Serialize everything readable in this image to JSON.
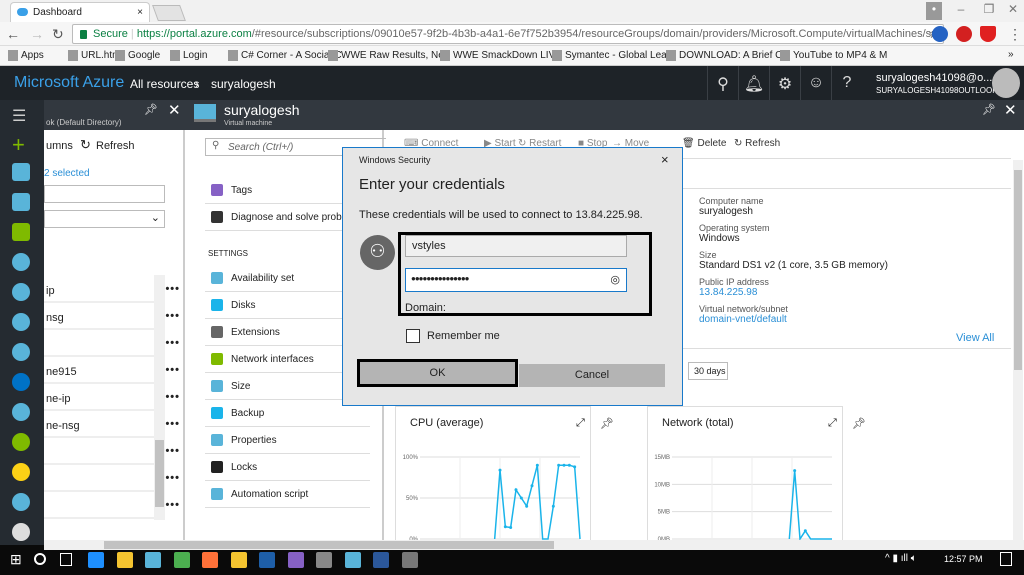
{
  "browser": {
    "tab_title": "Dashboard",
    "secure_label": "Secure",
    "url_host": "https://portal.azure.com",
    "url_rest": "/#resource/subscriptions/09010e57-9f2b-4b3b-a4a1-6e7f752b3954/resourceGroups/domain/providers/Microsoft.Compute/virtualMachines/su",
    "bookmarks": [
      "Apps",
      "URL.html",
      "Google",
      "Login",
      "C# Corner - A Social C",
      "WWE Raw Results, Ne",
      "WWE SmackDown LIV",
      "Symantec - Global Lea",
      "DOWNLOAD: A Brief C",
      "YouTube to MP4 & M"
    ],
    "more": "»"
  },
  "azure": {
    "brand": "Microsoft Azure",
    "crumbs": [
      "All resources",
      "suryalogesh"
    ],
    "user_email": "suryalogesh41098@o...",
    "user_dir": "SURYALOGESH41098OUTLOOK..."
  },
  "blade1": {
    "subtitle": "ok (Default Directory)",
    "columns_label": "umns",
    "refresh_label": "Refresh",
    "selected_label": "2 selected",
    "rows": [
      "ip",
      "nsg",
      "",
      "ne915",
      "ne-ip",
      "ne-nsg",
      "",
      "",
      ""
    ]
  },
  "blade2": {
    "title": "suryalogesh",
    "subtitle": "Virtual machine",
    "search_placeholder": "Search (Ctrl+/)",
    "items_top": [
      "Tags",
      "Diagnose and solve problems"
    ],
    "settings_header": "SETTINGS",
    "settings": [
      "Availability set",
      "Disks",
      "Extensions",
      "Network interfaces",
      "Size",
      "Backup",
      "Properties",
      "Locks",
      "Automation script"
    ]
  },
  "blade3": {
    "toolbar": [
      "Connect",
      "Start",
      "Restart",
      "Stop",
      "Move",
      "Delete",
      "Refresh"
    ],
    "props": [
      {
        "label": "Computer name",
        "value": "suryalogesh"
      },
      {
        "label": "Operating system",
        "value": "Windows"
      },
      {
        "label": "Size",
        "value": "Standard DS1 v2 (1 core, 3.5 GB memory)"
      },
      {
        "label": "Public IP address",
        "value": "13.84.225.98"
      },
      {
        "label": "Virtual network/subnet",
        "value": "domain-vnet/default"
      }
    ],
    "view_all": "View All",
    "range_button": "30 days"
  },
  "charts": [
    {
      "title": "CPU (average)",
      "yticks": [
        "100%",
        "50%",
        "0%"
      ],
      "ymax": 100,
      "values": [
        0,
        0,
        0,
        0,
        0,
        0,
        0,
        0,
        0,
        0,
        0,
        0,
        0,
        0,
        0,
        84,
        15,
        14,
        60,
        50,
        40,
        65,
        90,
        0,
        0,
        40,
        90,
        90,
        90,
        88,
        0
      ]
    },
    {
      "title": "Network (total)",
      "yticks": [
        "15MB",
        "10MB",
        "5MB",
        "0MB"
      ],
      "ymax": 15,
      "values": [
        0,
        0,
        0,
        0,
        0,
        0,
        0,
        0,
        0,
        0,
        0,
        0,
        0,
        0,
        0,
        0,
        0,
        0,
        0,
        0,
        0,
        0,
        0,
        12.5,
        0,
        1.5,
        0,
        0,
        0,
        0,
        0
      ]
    }
  ],
  "dialog": {
    "window_title": "Windows Security",
    "heading": "Enter your credentials",
    "message": "These credentials will be used to connect to 13.84.225.98.",
    "username": "vstyles",
    "password": "●●●●●●●●●●●●●●●",
    "domain_label": "Domain:",
    "remember_label": "Remember me",
    "ok_label": "OK",
    "cancel_label": "Cancel"
  },
  "taskbar": {
    "time": "12:57 PM"
  },
  "colors": {
    "accent": "#1979ca",
    "azure_link": "#2a8fd6",
    "chart_line": "#1ab4ea"
  }
}
